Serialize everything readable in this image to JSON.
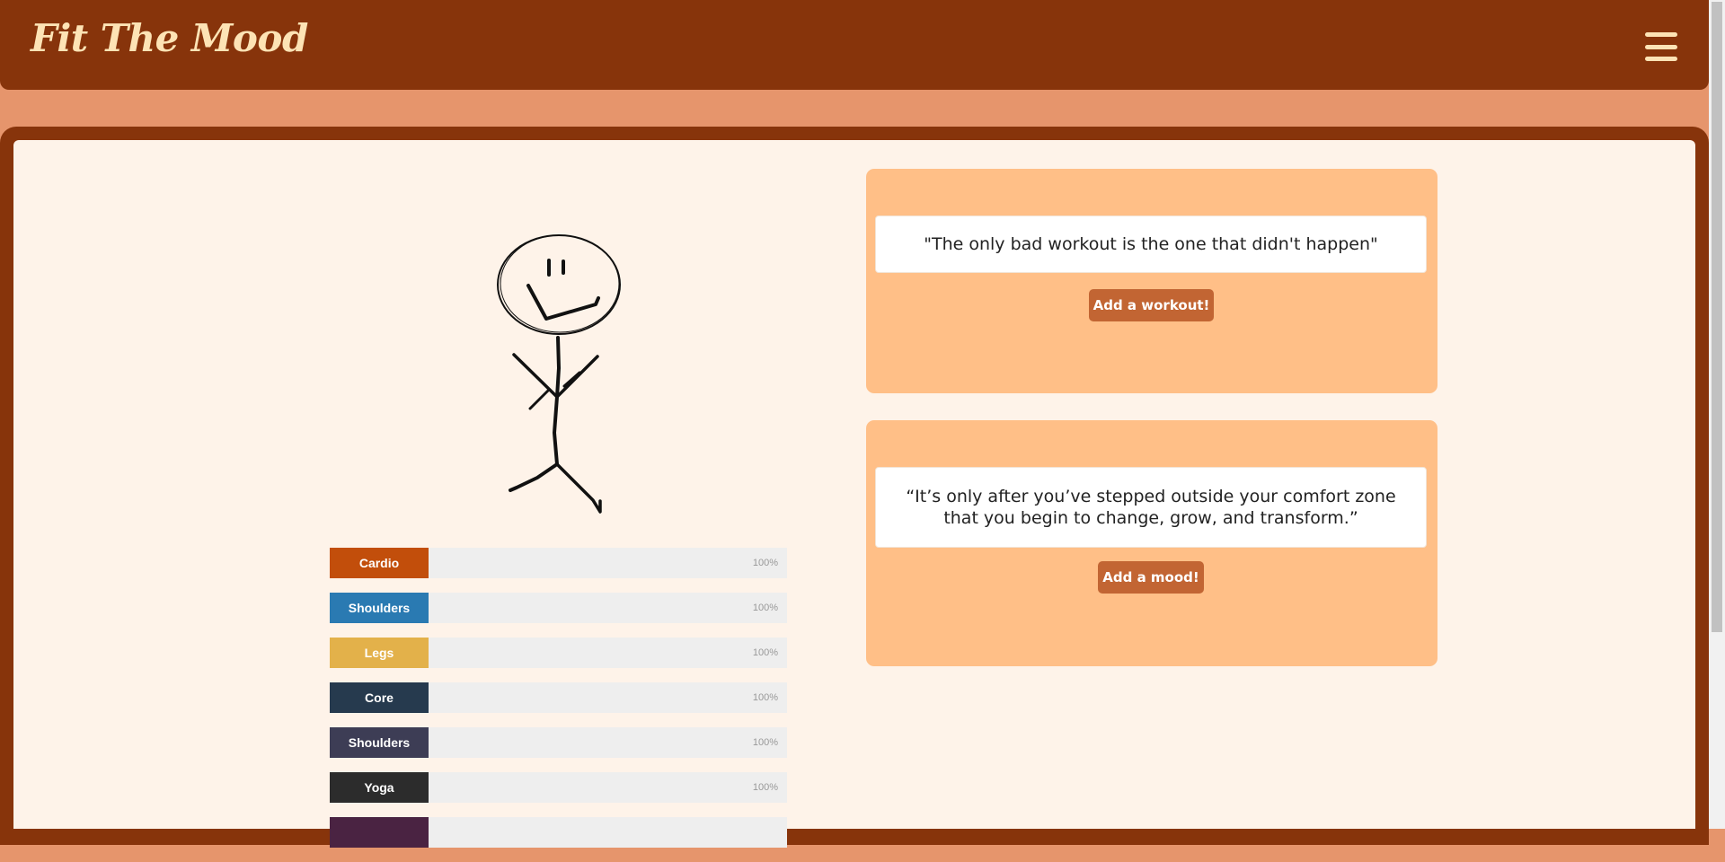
{
  "navbar": {
    "brand": "Fit The Mood",
    "menu_icon": "hamburger-menu-icon"
  },
  "illustration": {
    "icon": "stick-figure-illustration"
  },
  "skills": [
    {
      "label": "Cardio",
      "percent": "100%",
      "color": "#c24e0b"
    },
    {
      "label": "Shoulders",
      "percent": "100%",
      "color": "#2a7ab2"
    },
    {
      "label": "Legs",
      "percent": "100%",
      "color": "#e3b14a"
    },
    {
      "label": "Core",
      "percent": "100%",
      "color": "#263a4e"
    },
    {
      "label": "Shoulders",
      "percent": "100%",
      "color": "#3d3d55"
    },
    {
      "label": "Yoga",
      "percent": "100%",
      "color": "#2c2c2c"
    },
    {
      "label": "",
      "percent": "",
      "color": "#4a2342"
    }
  ],
  "workout_card": {
    "quote": "\"The only bad workout is the one that didn't happen\"",
    "button": "Add a workout!"
  },
  "mood_card": {
    "quote": "“It’s only after you’ve stepped outside your comfort zone that you begin to change, grow, and transform.”",
    "button": "Add a mood!"
  },
  "colors": {
    "navbar": "#87340b",
    "page_background": "#e6956c",
    "content_background": "#fef3e9",
    "card": "#ffbf87",
    "button": "#c26533",
    "brand_text": "#fde3b5"
  }
}
